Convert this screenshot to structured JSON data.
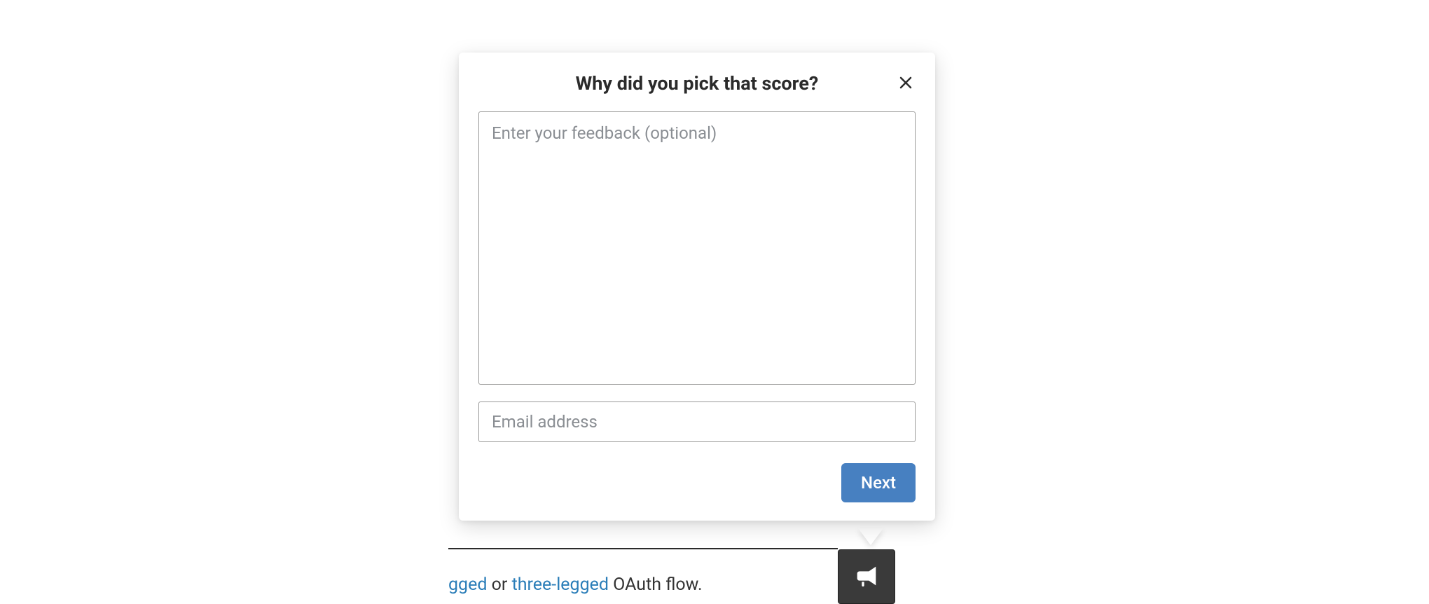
{
  "popover": {
    "title": "Why did you pick that score?",
    "feedback_placeholder": "Enter your feedback (optional)",
    "email_placeholder": "Email address",
    "next_label": "Next"
  },
  "background": {
    "text_frag_1": "gged",
    "text_or": " or ",
    "link_three": "three-legged",
    "text_suffix": " OAuth flow."
  },
  "icons": {
    "close": "close-icon",
    "megaphone": "megaphone-icon"
  }
}
